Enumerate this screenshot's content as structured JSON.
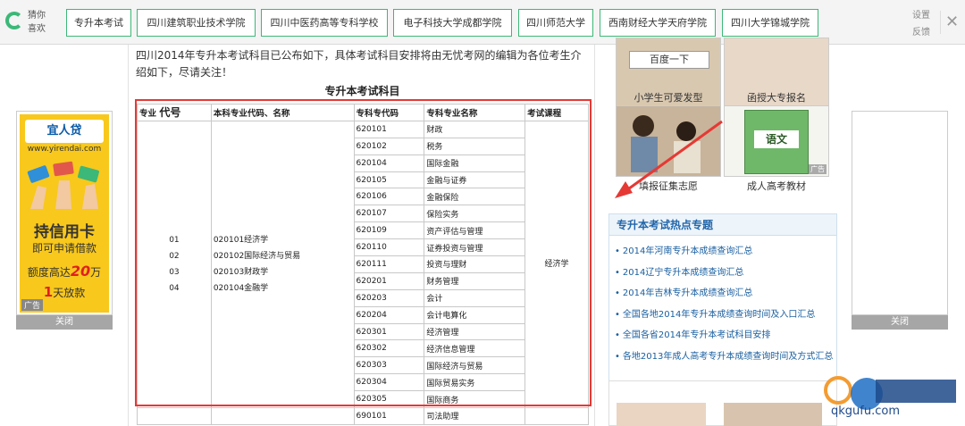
{
  "topbar": {
    "guess_label": "猜你喜欢",
    "tags": [
      "专升本考试",
      "四川建筑职业技术学院",
      "四川中医药高等专科学校",
      "电子科技大学成都学院",
      "四川师范大学",
      "西南财经大学天府学院",
      "四川大学锦城学院"
    ],
    "settings_label": "设置",
    "feedback_label": "反馈",
    "close_symbol": "✕"
  },
  "left_ad": {
    "brand": "宜人贷",
    "site": "www.yirendai.com",
    "headline": "持信用卡",
    "subline": "即可申请借款",
    "limit_prefix": "额度高达",
    "limit_value": "20",
    "limit_unit": "万",
    "fast_value": "1",
    "fast_text": "天放款",
    "ad_label": "广告",
    "close_label": "关闭"
  },
  "right_ad": {
    "close_label": "关闭"
  },
  "article": {
    "intro": "四川2014年专升本考试科目已公布如下，具体考试科目安排将由无忧考网的编辑为各位考生介绍如下，尽请关注！",
    "table_title": "专升本考试科目",
    "headers": [
      "专业代号",
      "本科专业代码、名称",
      "专科专代码",
      "专科专业名称",
      "考试课程"
    ],
    "header_first_small": "专业",
    "header_first_big": "代号",
    "major_codes": [
      "01",
      "02",
      "03",
      "04"
    ],
    "undergrad_majors": [
      "020101经济学",
      "020102国际经济与贸易",
      "020103财政学",
      "020104金融学"
    ],
    "exam_course": "经济学",
    "specialties": [
      [
        "620101",
        "财政"
      ],
      [
        "620102",
        "税务"
      ],
      [
        "620104",
        "国际金融"
      ],
      [
        "620105",
        "金融与证券"
      ],
      [
        "620106",
        "金融保险"
      ],
      [
        "620107",
        "保险实务"
      ],
      [
        "620109",
        "资产评估与管理"
      ],
      [
        "620110",
        "证券投资与管理"
      ],
      [
        "620111",
        "投资与理财"
      ],
      [
        "620201",
        "财务管理"
      ],
      [
        "620203",
        "会计"
      ],
      [
        "620204",
        "会计电算化"
      ],
      [
        "620301",
        "经济管理"
      ],
      [
        "620302",
        "经济信息管理"
      ],
      [
        "620303",
        "国际经济与贸易"
      ],
      [
        "620304",
        "国际贸易实务"
      ],
      [
        "620305",
        "国际商务"
      ],
      [
        "690101",
        "司法助理"
      ]
    ]
  },
  "sidebar": {
    "thumbs": [
      {
        "caption": "小学生可爱发型",
        "overlay": "百度一下"
      },
      {
        "caption": "函授大专报名"
      },
      {
        "caption": "填报征集志愿"
      },
      {
        "caption": "成人高考教材",
        "overlay": "语文",
        "ad_label": "广告"
      }
    ],
    "hot_title": "专升本考试热点专题",
    "hot_items": [
      "2014年河南专升本成绩查询汇总",
      "2014辽宁专升本成绩查询汇总",
      "2014年吉林专升本成绩查询汇总",
      "全国各地2014年专升本成绩查询时间及入口汇总",
      "全国各省2014年专升本考试科目安排",
      "各地2013年成人高考专升本成绩查询时间及方式汇总"
    ]
  },
  "watermark": {
    "text": "qkgufu.com"
  },
  "colors": {
    "accent_green": "#3cb878",
    "highlight_red": "#e53935",
    "link_blue": "#1a5fa0",
    "ad_yellow": "#f8c81c"
  }
}
